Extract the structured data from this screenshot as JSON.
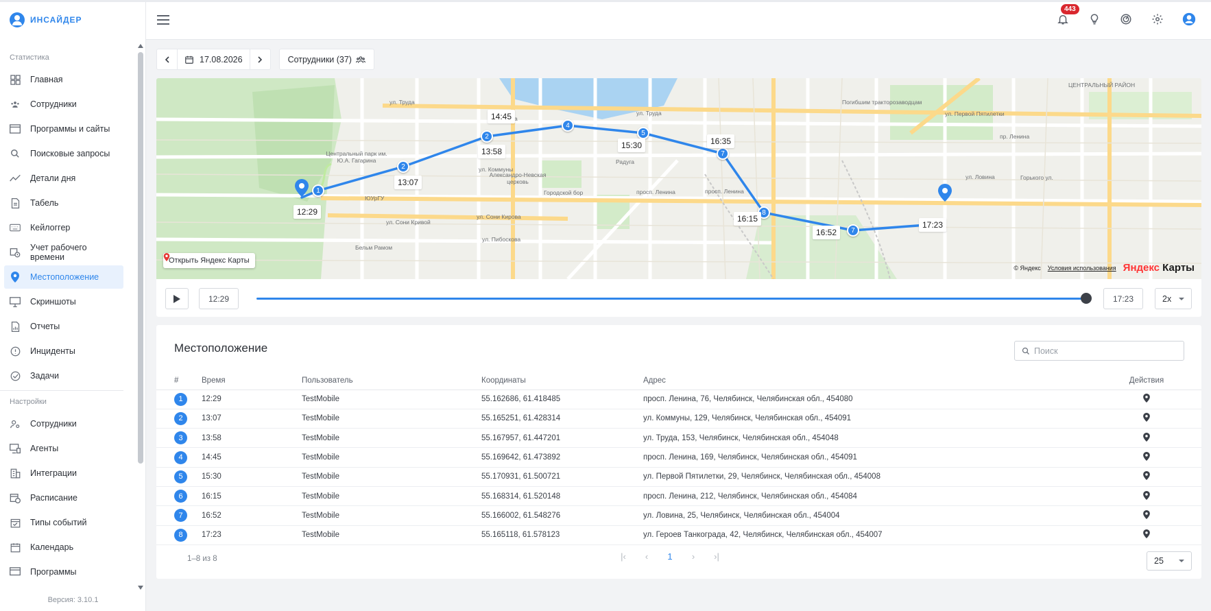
{
  "brand": {
    "name": "ИНСАЙДЕР"
  },
  "sidebar": {
    "section_stats": "Статистика",
    "stats_items": [
      {
        "label": "Главная",
        "icon": "dashboard-icon"
      },
      {
        "label": "Сотрудники",
        "icon": "users-icon"
      },
      {
        "label": "Программы и сайты",
        "icon": "window-icon"
      },
      {
        "label": "Поисковые запросы",
        "icon": "search-icon"
      },
      {
        "label": "Детали дня",
        "icon": "trend-icon"
      },
      {
        "label": "Табель",
        "icon": "document-icon"
      },
      {
        "label": "Кейлоггер",
        "icon": "keyboard-icon"
      },
      {
        "label": "Учет рабочего времени",
        "icon": "clock-calendar-icon"
      },
      {
        "label": "Местоположение",
        "icon": "location-pin-icon"
      },
      {
        "label": "Скриншоты",
        "icon": "monitor-icon"
      },
      {
        "label": "Отчеты",
        "icon": "report-icon"
      },
      {
        "label": "Инциденты",
        "icon": "alert-icon"
      },
      {
        "label": "Задачи",
        "icon": "check-circle-icon"
      }
    ],
    "section_settings": "Настройки",
    "settings_items": [
      {
        "label": "Сотрудники",
        "icon": "users-settings-icon"
      },
      {
        "label": "Агенты",
        "icon": "agent-monitor-icon"
      },
      {
        "label": "Интеграции",
        "icon": "building-icon"
      },
      {
        "label": "Расписание",
        "icon": "schedule-icon"
      },
      {
        "label": "Типы событий",
        "icon": "calendar-check-icon"
      },
      {
        "label": "Календарь",
        "icon": "calendar-icon"
      },
      {
        "label": "Программы",
        "icon": "programs-icon"
      }
    ],
    "version": "Версия: 3.10.1"
  },
  "topbar": {
    "notifications_count": "443"
  },
  "toolbar": {
    "date": "17.08.2026",
    "employees": "Сотрудники (37)"
  },
  "map": {
    "open_link": "Открыть Яндекс Карты",
    "copyright": "© Яндекс",
    "terms": "Условия использования",
    "logo_a": "Яндекс",
    "logo_b": " Карты",
    "time_labels": [
      "12:29",
      "13:07",
      "13:58",
      "14:45",
      "15:30",
      "16:35",
      "16:15",
      "16:52",
      "17:23"
    ],
    "street_labels": [
      "ул. Труда",
      "ул. Труда",
      "ул. Труда",
      "ул. Первой Пятилетки",
      "пр. Ленина",
      "просп. Ленина",
      "просп. Ленина",
      "ул. Коммуны",
      "ул. Сони Кривой",
      "ул. Сони Кирова",
      "ул. Пибоскова",
      "Центральный парк им. Ю.А. Гагарина",
      "Александро-Невская церковь",
      "Городской бор",
      "Погибшим тракторозаводцам",
      "ЮУрГУ",
      "Радуга",
      "Бельм Рамом",
      "ул. Ловина",
      "Горького ул.",
      "ЦЕНТРАЛЬНЫЙ РАЙОН"
    ]
  },
  "player": {
    "start_time": "12:29",
    "end_time": "17:23",
    "speed": "2x",
    "progress": 1.0
  },
  "table": {
    "title": "Местоположение",
    "search_placeholder": "Поиск",
    "headers": [
      "#",
      "Время",
      "Пользователь",
      "Координаты",
      "Адрес",
      "Действия"
    ],
    "rows": [
      {
        "n": "1",
        "time": "12:29",
        "user": "TestMobile",
        "coords": "55.162686, 61.418485",
        "addr": "просп. Ленина, 76, Челябинск, Челябинская обл., 454080"
      },
      {
        "n": "2",
        "time": "13:07",
        "user": "TestMobile",
        "coords": "55.165251, 61.428314",
        "addr": "ул. Коммуны, 129, Челябинск, Челябинская обл., 454091"
      },
      {
        "n": "3",
        "time": "13:58",
        "user": "TestMobile",
        "coords": "55.167957, 61.447201",
        "addr": "ул. Труда, 153, Челябинск, Челябинская обл., 454048"
      },
      {
        "n": "4",
        "time": "14:45",
        "user": "TestMobile",
        "coords": "55.169642, 61.473892",
        "addr": "просп. Ленина, 169, Челябинск, Челябинская обл., 454091"
      },
      {
        "n": "5",
        "time": "15:30",
        "user": "TestMobile",
        "coords": "55.170931, 61.500721",
        "addr": "ул. Первой Пятилетки, 29, Челябинск, Челябинская обл., 454008"
      },
      {
        "n": "6",
        "time": "16:15",
        "user": "TestMobile",
        "coords": "55.168314, 61.520148",
        "addr": "просп. Ленина, 212, Челябинск, Челябинская обл., 454084"
      },
      {
        "n": "7",
        "time": "16:52",
        "user": "TestMobile",
        "coords": "55.166002, 61.548276",
        "addr": "ул. Ловина, 25, Челябинск, Челябинская обл., 454004"
      },
      {
        "n": "8",
        "time": "17:23",
        "user": "TestMobile",
        "coords": "55.165118, 61.578123",
        "addr": "ул. Героев Танкограда, 42, Челябинск, Челябинская обл., 454007"
      }
    ],
    "count_text": "1–8 из 8",
    "current_page": "1",
    "per_page": "25"
  },
  "colors": {
    "accent": "#2f86eb",
    "badge": "#d9272e",
    "route": "#2f86eb"
  }
}
